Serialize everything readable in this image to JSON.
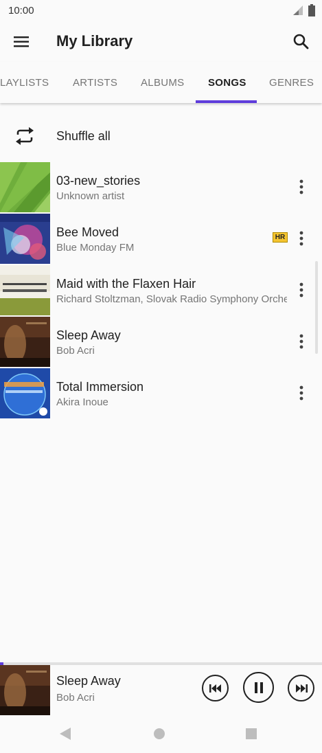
{
  "status_bar": {
    "time": "10:00",
    "icons": [
      "signal-icon",
      "battery-icon"
    ]
  },
  "app_bar": {
    "title": "My Library",
    "menu_icon": "menu-icon",
    "search_icon": "search-icon"
  },
  "tabs": {
    "items": [
      {
        "label": "LAYLISTS",
        "active": false
      },
      {
        "label": "ARTISTS",
        "active": false
      },
      {
        "label": "ALBUMS",
        "active": false
      },
      {
        "label": "SONGS",
        "active": true
      },
      {
        "label": "GENRES",
        "active": false
      }
    ]
  },
  "shuffle": {
    "label": "Shuffle all",
    "icon": "shuffle-icon"
  },
  "songs": [
    {
      "title": "03-new_stories",
      "artist": "Unknown artist",
      "hr": "",
      "art": "green-art"
    },
    {
      "title": "Bee Moved",
      "artist": "Blue Monday FM",
      "hr": "HR",
      "art": "blue-monday-art"
    },
    {
      "title": "Maid with the Flaxen Hair",
      "artist": "Richard Stoltzman, Slovak Radio Symphony Orchestra",
      "hr": "",
      "art": "stoltzman-art"
    },
    {
      "title": "Sleep Away",
      "artist": "Bob Acri",
      "hr": "",
      "art": "piano-art"
    },
    {
      "title": "Total Immersion",
      "artist": "Akira Inoue",
      "hr": "",
      "art": "akira-art"
    }
  ],
  "now_playing": {
    "title": "Sleep Away",
    "artist": "Bob Acri",
    "progress": 0.01
  },
  "colors": {
    "accent": "#5f3ddb",
    "hr_badge": "#f4c430",
    "text_primary": "#212121",
    "text_secondary": "#757575"
  },
  "nav_bar": {
    "icons": [
      "back-icon",
      "home-icon",
      "recents-icon"
    ]
  }
}
